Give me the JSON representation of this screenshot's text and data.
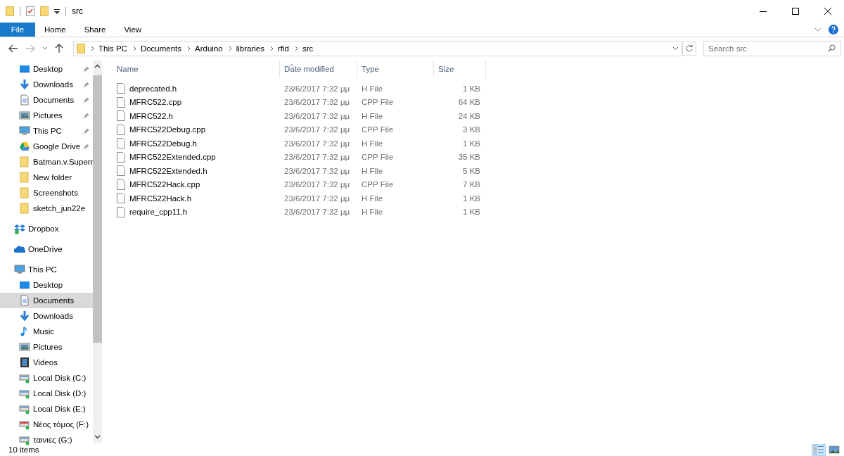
{
  "window": {
    "title": "src"
  },
  "ribbon": {
    "file_tab": "File",
    "tabs": [
      {
        "label": "Home",
        "selected": false
      },
      {
        "label": "Share",
        "selected": false
      },
      {
        "label": "View",
        "selected": false
      }
    ]
  },
  "address": {
    "crumbs": [
      "This PC",
      "Documents",
      "Arduino",
      "libraries",
      "rfid",
      "src"
    ]
  },
  "search": {
    "placeholder": "Search src"
  },
  "nav": {
    "quick_items": [
      {
        "label": "Desktop",
        "kind": "desktop",
        "pinned": true,
        "selected": false
      },
      {
        "label": "Downloads",
        "kind": "download",
        "pinned": true,
        "selected": false
      },
      {
        "label": "Documents",
        "kind": "document",
        "pinned": true,
        "selected": false
      },
      {
        "label": "Pictures",
        "kind": "pictures",
        "pinned": true,
        "selected": false
      },
      {
        "label": "This PC",
        "kind": "pc",
        "pinned": true,
        "selected": false
      },
      {
        "label": "Google Drive",
        "kind": "gdrive",
        "pinned": true,
        "selected": false
      },
      {
        "label": "Batman.v.Superr",
        "kind": "folder",
        "pinned": false,
        "selected": false
      },
      {
        "label": "New folder",
        "kind": "folder",
        "pinned": false,
        "selected": false
      },
      {
        "label": "Screenshots",
        "kind": "folder",
        "pinned": false,
        "selected": false
      },
      {
        "label": "sketch_jun22e",
        "kind": "folder",
        "pinned": false,
        "selected": false
      }
    ],
    "roots": [
      {
        "label": "Dropbox",
        "kind": "dropbox"
      },
      {
        "label": "OneDrive",
        "kind": "onedrive"
      },
      {
        "label": "This PC",
        "kind": "pc",
        "children": [
          {
            "label": "Desktop",
            "kind": "desktop",
            "selected": false
          },
          {
            "label": "Documents",
            "kind": "document",
            "selected": true
          },
          {
            "label": "Downloads",
            "kind": "download",
            "selected": false
          },
          {
            "label": "Music",
            "kind": "music",
            "selected": false
          },
          {
            "label": "Pictures",
            "kind": "pictures",
            "selected": false
          },
          {
            "label": "Videos",
            "kind": "videos",
            "selected": false
          },
          {
            "label": "Local Disk (C:)",
            "kind": "disk",
            "selected": false
          },
          {
            "label": "Local Disk (D:)",
            "kind": "disk",
            "selected": false
          },
          {
            "label": "Local Disk (E:)",
            "kind": "disk",
            "selected": false
          },
          {
            "label": "Νέος τόμος (F:)",
            "kind": "disk-red",
            "selected": false
          },
          {
            "label": "ταινιες (G:)",
            "kind": "disk",
            "selected": false
          }
        ]
      }
    ]
  },
  "table": {
    "columns": [
      "Name",
      "Date modified",
      "Type",
      "Size"
    ],
    "rows": [
      {
        "name": "deprecated.h",
        "date": "23/6/2017 7:32 μμ",
        "type": "H File",
        "size": "1 KB"
      },
      {
        "name": "MFRC522.cpp",
        "date": "23/6/2017 7:32 μμ",
        "type": "CPP File",
        "size": "64 KB"
      },
      {
        "name": "MFRC522.h",
        "date": "23/6/2017 7:32 μμ",
        "type": "H File",
        "size": "24 KB"
      },
      {
        "name": "MFRC522Debug.cpp",
        "date": "23/6/2017 7:32 μμ",
        "type": "CPP File",
        "size": "3 KB"
      },
      {
        "name": "MFRC522Debug.h",
        "date": "23/6/2017 7:32 μμ",
        "type": "H File",
        "size": "1 KB"
      },
      {
        "name": "MFRC522Extended.cpp",
        "date": "23/6/2017 7:32 μμ",
        "type": "CPP File",
        "size": "35 KB"
      },
      {
        "name": "MFRC522Extended.h",
        "date": "23/6/2017 7:32 μμ",
        "type": "H File",
        "size": "5 KB"
      },
      {
        "name": "MFRC522Hack.cpp",
        "date": "23/6/2017 7:32 μμ",
        "type": "CPP File",
        "size": "7 KB"
      },
      {
        "name": "MFRC522Hack.h",
        "date": "23/6/2017 7:32 μμ",
        "type": "H File",
        "size": "1 KB"
      },
      {
        "name": "require_cpp11.h",
        "date": "23/6/2017 7:32 μμ",
        "type": "H File",
        "size": "1 KB"
      }
    ]
  },
  "status_bar": {
    "count": "10 items",
    "views": [
      {
        "kind": "details",
        "selected": true
      },
      {
        "kind": "thumbnails",
        "selected": false
      }
    ]
  }
}
